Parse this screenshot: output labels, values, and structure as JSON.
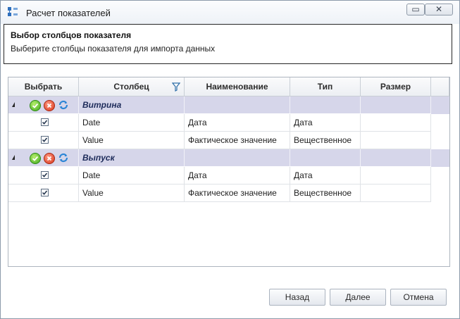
{
  "window": {
    "title": "Расчет показателей"
  },
  "header": {
    "title": "Выбор столбцов показателя",
    "subtitle": "Выберите столбцы показателя для импорта данных"
  },
  "grid": {
    "columns": [
      "Выбрать",
      "Столбец",
      "Наименование",
      "Тип",
      "Размер"
    ],
    "groups": [
      {
        "name": "Витрина",
        "rows": [
          {
            "checked": true,
            "column": "Date",
            "name": "Дата",
            "type": "Дата",
            "size": ""
          },
          {
            "checked": true,
            "column": "Value",
            "name": "Фактическое значение",
            "type": "Вещественное",
            "size": ""
          }
        ]
      },
      {
        "name": "Выпуск",
        "rows": [
          {
            "checked": true,
            "column": "Date",
            "name": "Дата",
            "type": "Дата",
            "size": ""
          },
          {
            "checked": true,
            "column": "Value",
            "name": "Фактическое значение",
            "type": "Вещественное",
            "size": ""
          }
        ]
      }
    ]
  },
  "buttons": {
    "back": "Назад",
    "next": "Далее",
    "cancel": "Отмена"
  },
  "colors": {
    "group_row": "#d6d6ea",
    "group_text": "#1d2b5a",
    "border": "#adb5bf"
  },
  "icons": {
    "window": "app-grid-icon",
    "minimize": "minimize-icon",
    "close": "close-icon",
    "filter": "filter-icon",
    "group_expander": "collapse-triangle-icon",
    "select_all": "check-all-icon",
    "deselect_all": "uncheck-all-icon",
    "invert": "invert-selection-icon"
  }
}
